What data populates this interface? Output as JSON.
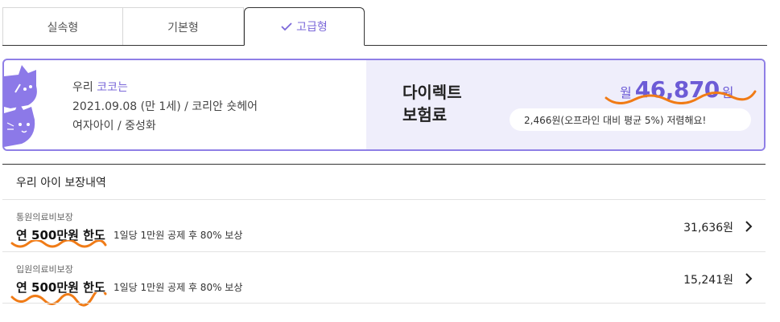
{
  "tabs": [
    {
      "label": "실속형",
      "active": false
    },
    {
      "label": "기본형",
      "active": false
    },
    {
      "label": "고급형",
      "active": true
    }
  ],
  "pet": {
    "prefix": "우리",
    "name": "코코는",
    "birth_breed": "2021.09.08 (만 1세) / 코리안 숏헤어",
    "gender_status": "여자아이 / 중성화"
  },
  "premium": {
    "label_line1": "다이렉트",
    "label_line2": "보험료",
    "price_unit": "월",
    "price_amount": "46,870",
    "price_won": "원",
    "savings_text": "2,466원(오프라인 대비 평균 5%) 저렴해요!"
  },
  "coverage": {
    "title": "우리 아이 보장내역",
    "items": [
      {
        "category": "통원의료비보장",
        "limit": "연 500만원 한도",
        "description": "1일당 1만원 공제 후 80% 보상",
        "amount": "31,636원"
      },
      {
        "category": "입원의료비보장",
        "limit": "연 500만원 한도",
        "description": "1일당 1만원 공제 후 80% 보상",
        "amount": "15,241원"
      }
    ]
  },
  "colors": {
    "accent": "#7b68d9",
    "card_border": "#8f7fe6",
    "card_panel": "#efeefb",
    "annotation": "#f07b16"
  }
}
